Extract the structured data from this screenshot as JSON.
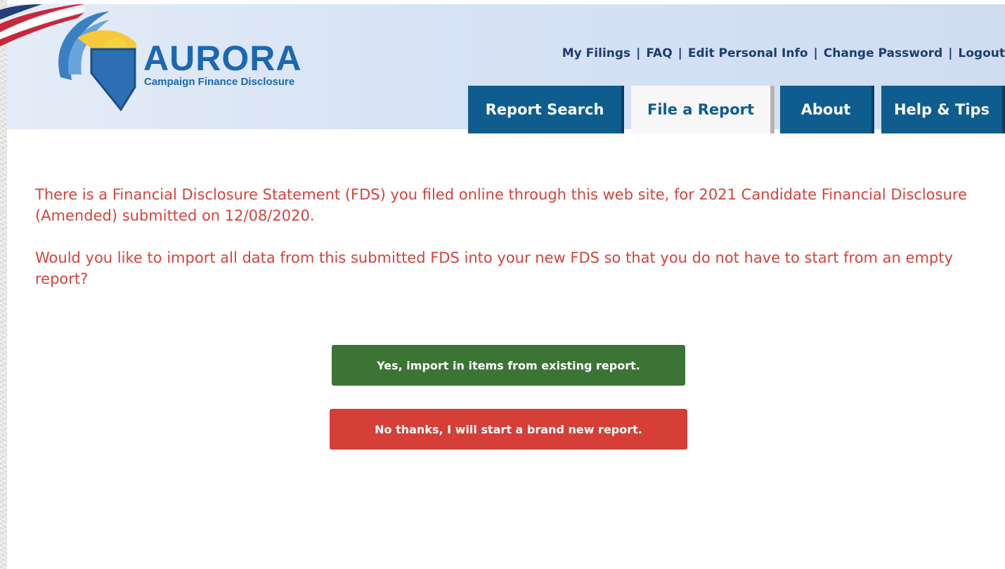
{
  "logo": {
    "word": "AURORA",
    "tagline": "Campaign Finance Disclosure"
  },
  "top_links": [
    {
      "label": "My Filings"
    },
    {
      "label": "FAQ"
    },
    {
      "label": "Edit Personal Info"
    },
    {
      "label": "Change Password"
    },
    {
      "label": "Logout"
    }
  ],
  "tabs": [
    {
      "label": "Report Search",
      "active": false
    },
    {
      "label": "File a Report",
      "active": true
    },
    {
      "label": "About",
      "active": false
    },
    {
      "label": "Help & Tips",
      "active": false
    }
  ],
  "message": {
    "paragraph1": "There is a Financial Disclosure Statement (FDS) you filed online through this web site, for 2021 Candidate Financial Disclosure (Amended) submitted on 12/08/2020.",
    "paragraph2": "Would you like to import all data from this submitted FDS into your new FDS so that you do not have to start from an empty report?"
  },
  "buttons": {
    "yes_label": "Yes, import in items from existing report.",
    "no_label": "No thanks, I will start a brand new report."
  },
  "colors": {
    "brand_blue": "#1b68b1",
    "tab_blue": "#0e5d8e",
    "message_red": "#d6423a",
    "yes_green": "#3b7434",
    "no_red": "#d53f37"
  },
  "icons": [
    "us-flag-icon",
    "nevada-logo-icon"
  ]
}
